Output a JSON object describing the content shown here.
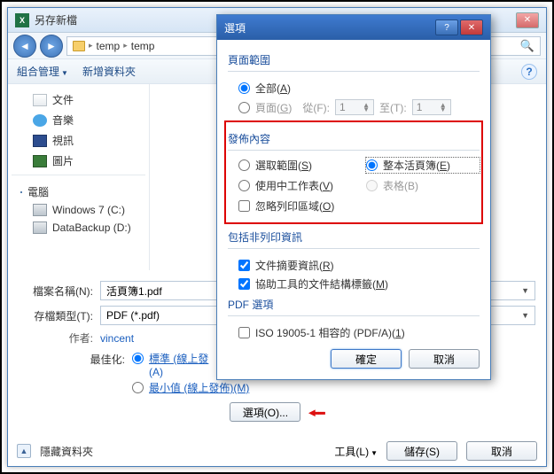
{
  "main": {
    "title": "另存新檔",
    "path": {
      "seg1": "temp",
      "seg2": "temp"
    },
    "toolbar": {
      "organize": "組合管理",
      "newfolder": "新增資料夾"
    },
    "tree": {
      "documents": "文件",
      "music": "音樂",
      "video": "視訊",
      "pictures": "圖片",
      "computer": "電腦",
      "drive_c": "Windows 7 (C:)",
      "drive_d": "DataBackup (D:)"
    },
    "form": {
      "filename_label": "檔案名稱(N):",
      "filename_value": "活頁簿1.pdf",
      "filetype_label": "存檔類型(T):",
      "filetype_value": "PDF (*.pdf)",
      "author_label": "作者:",
      "author_value": "vincent",
      "best_label": "最佳化:",
      "opt_standard": "標準 (線上發佈和列印)(A)",
      "opt_standard_short": "標準 (線上發",
      "opt_standard_a": "(A)",
      "opt_min": "最小值 (線上發佈)(M)",
      "options_btn": "選項(O)..."
    },
    "footer": {
      "hidden": "隱藏資料夾",
      "tools": "工具(L)",
      "save": "儲存(S)",
      "cancel": "取消"
    }
  },
  "opt": {
    "title": "選項",
    "page_range": "頁面範圍",
    "all": "全部(A)",
    "pages": "頁面(G)",
    "from": "從(F):",
    "to": "至(T):",
    "from_val": "1",
    "to_val": "1",
    "publish": "發佈內容",
    "selection": "選取範圍(S)",
    "workbook": "整本活頁簿(E)",
    "activesheet": "使用中工作表(V)",
    "table": "表格(B)",
    "ignoreprint": "忽略列印區域(O)",
    "nonprint": "包括非列印資訊",
    "docprops": "文件摘要資訊(R)",
    "a11y": "協助工具的文件結構標籤(M)",
    "pdfopts": "PDF 選項",
    "iso": "ISO 19005-1 相容的 (PDF/A)(1)",
    "ok": "確定",
    "cancel": "取消"
  }
}
